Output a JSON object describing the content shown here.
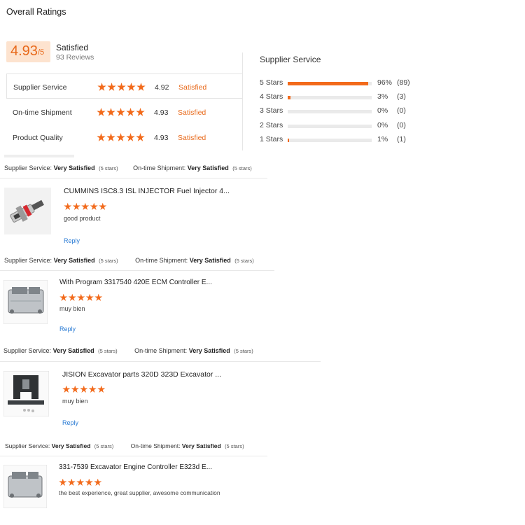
{
  "header": {
    "title": "Overall Ratings"
  },
  "summary": {
    "score": "4.93",
    "score_max": "/5",
    "label": "Satisfied",
    "reviews": "93 Reviews"
  },
  "ratings": [
    {
      "name": "Supplier Service",
      "stars": 5,
      "value": "4.92",
      "status": "Satisfied"
    },
    {
      "name": "On-time Shipment",
      "stars": 5,
      "value": "4.93",
      "status": "Satisfied"
    },
    {
      "name": "Product Quality",
      "stars": 5,
      "value": "4.93",
      "status": "Satisfied"
    }
  ],
  "distribution": {
    "title": "Supplier Service",
    "rows": [
      {
        "label": "5 Stars",
        "percent": "96%",
        "count": "(89)",
        "fill": 0.96
      },
      {
        "label": "4 Stars",
        "percent": "3%",
        "count": "(3)",
        "fill": 0.03
      },
      {
        "label": "3 Stars",
        "percent": "0%",
        "count": "(0)",
        "fill": 0
      },
      {
        "label": "2 Stars",
        "percent": "0%",
        "count": "(0)",
        "fill": 0
      },
      {
        "label": "1 Stars",
        "percent": "1%",
        "count": "(1)",
        "fill": 0.01
      }
    ]
  },
  "meta_labels": {
    "supplier": "Supplier Service:",
    "shipment": "On-time Shipment:",
    "very_satisfied": "Very Satisfied",
    "five_stars": "(5 stars)"
  },
  "reviews": [
    {
      "title": "CUMMINS ISC8.3 ISL INJECTOR Fuel Injector 4...",
      "stars": 5,
      "text": "good product",
      "reply": "Reply",
      "thumb": "injector-photo"
    },
    {
      "title": "With Program 3317540 420E ECM Controller E...",
      "stars": 5,
      "text": "muy bien",
      "reply": "Reply",
      "thumb": "ecm-photo"
    },
    {
      "title": "JISION Excavator parts 320D 323D Excavator ...",
      "stars": 5,
      "text": "muy bien",
      "reply": "Reply",
      "thumb": "bracket-photo"
    },
    {
      "title": "331-7539 Excavator Engine Controller E323d E...",
      "stars": 5,
      "text": "the best experience, great supplier, awesome communication",
      "thumb": "controller-photo"
    }
  ],
  "colors": {
    "accent": "#f26a1b",
    "accent_text": "#e8691a",
    "score_bg": "#fde3cf",
    "link": "#2a7bd4"
  }
}
